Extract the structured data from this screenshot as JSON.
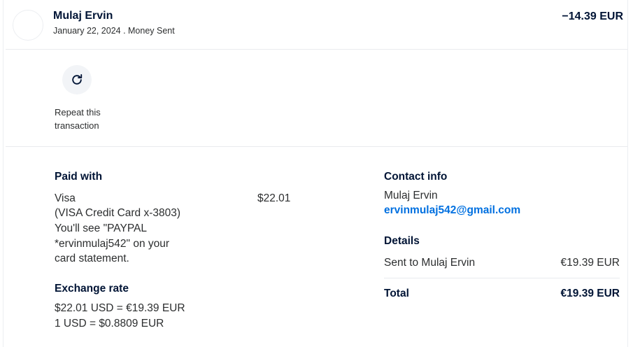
{
  "transaction": {
    "name": "Mulaj Ervin",
    "subtitle": "January 22, 2024 . Money Sent",
    "amount": "−14.39 EUR"
  },
  "repeat": {
    "icon": "repeat-icon",
    "label": "Repeat this transaction"
  },
  "paid_with": {
    "heading": "Paid with",
    "method": "Visa",
    "card": "(VISA Credit Card x-3803)",
    "note_line1": "You'll see \"PAYPAL",
    "note_line2": "*ervinmulaj542\" on your",
    "note_line3": "card statement.",
    "amount": "$22.01"
  },
  "exchange_rate": {
    "heading": "Exchange rate",
    "line1": "$22.01 USD = €19.39 EUR",
    "line2": "1 USD = $0.8809 EUR"
  },
  "contact_info": {
    "heading": "Contact info",
    "name": "Mulaj Ervin",
    "email": "ervinmulaj542@gmail.com"
  },
  "details": {
    "heading": "Details",
    "row_label": "Sent to Mulaj Ervin",
    "row_value": "€19.39 EUR",
    "total_label": "Total",
    "total_value": "€19.39 EUR"
  },
  "colors": {
    "heading": "#001435",
    "text": "#2c2e2f",
    "link": "#0070e0",
    "divider": "#e9ebee"
  }
}
